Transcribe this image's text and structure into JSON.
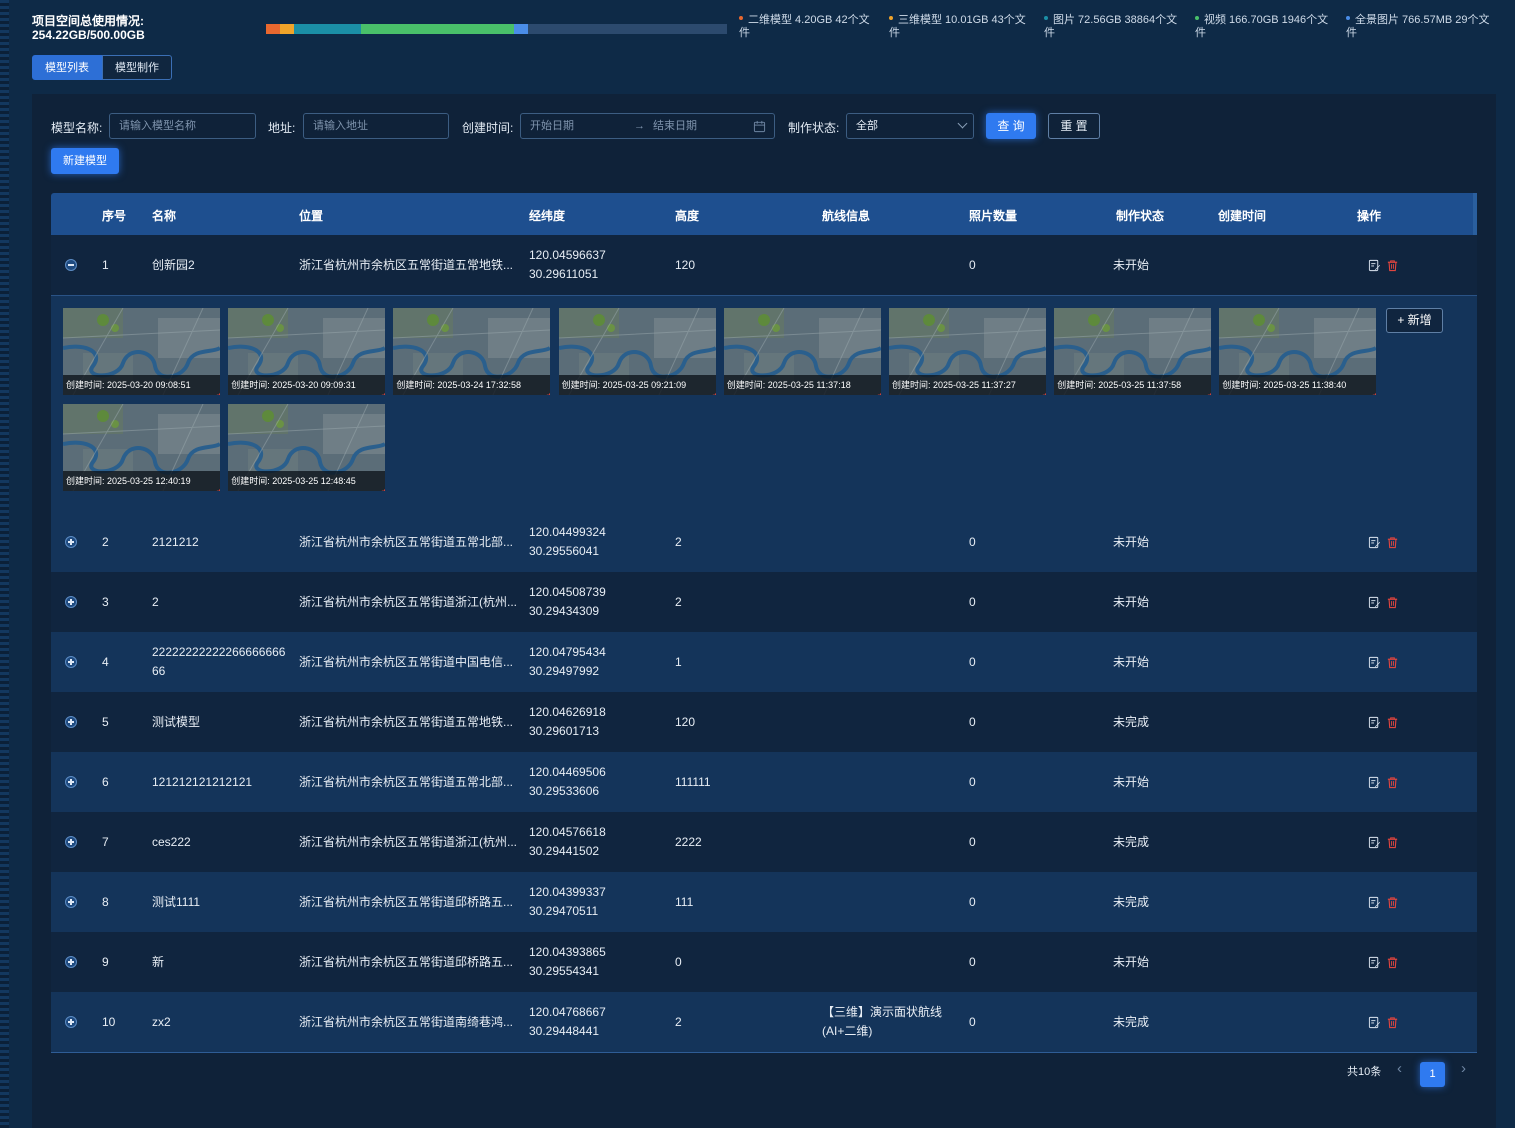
{
  "storage": {
    "title_line1": "项目空间总使用情况:",
    "title_line2": "254.22GB/500.00GB",
    "used_fraction": 0.508,
    "segments": [
      {
        "label": "二维模型 4.20GB 42个文件",
        "color": "#e8682f",
        "gb": 4.2
      },
      {
        "label": "三维模型 10.01GB 43个文件",
        "color": "#f0a42a",
        "gb": 10.01
      },
      {
        "label": "图片 72.56GB 38864个文件",
        "color": "#1b8fa6",
        "gb": 72.56
      },
      {
        "label": "视频 166.70GB 1946个文件",
        "color": "#49c06a",
        "gb": 166.7
      },
      {
        "label": "全景图片 766.57MB 29个文件",
        "color": "#4a8de8",
        "gb": 0.75
      }
    ],
    "legend": [
      {
        "line1": "二维模型 4.20GB 42个文",
        "line2": "件",
        "color": "#e8682f"
      },
      {
        "line1": "三维模型 10.01GB 43个文",
        "line2": "件",
        "color": "#f0a42a"
      },
      {
        "line1": "图片 72.56GB 38864个文",
        "line2": "件",
        "color": "#1b8fa6"
      },
      {
        "line1": "视频 166.70GB 1946个文",
        "line2": "件",
        "color": "#49c06a"
      },
      {
        "line1": "全景图片 766.57MB 29个文",
        "line2": "件",
        "color": "#4a8de8"
      }
    ]
  },
  "tabs": [
    {
      "label": "模型列表",
      "active": true
    },
    {
      "label": "模型制作",
      "active": false
    }
  ],
  "filters": {
    "name_label": "模型名称:",
    "name_placeholder": "请输入模型名称",
    "address_label": "地址:",
    "address_placeholder": "请输入地址",
    "time_label": "创建时间:",
    "start_placeholder": "开始日期",
    "range_sep": "→",
    "end_placeholder": "结束日期",
    "status_label": "制作状态:",
    "status_value": "全部",
    "query_label": "查 询",
    "reset_label": "重 置",
    "new_label": "新建模型"
  },
  "table": {
    "columns": [
      "序号",
      "名称",
      "位置",
      "经纬度",
      "高度",
      "航线信息",
      "照片数量",
      "制作状态",
      "创建时间",
      "操作"
    ],
    "rows": [
      {
        "index": "1",
        "name": "创新园2",
        "location": "浙江省杭州市余杭区五常街道五常地铁...",
        "lng": "120.04596637",
        "lat": "30.29611051",
        "height": "120",
        "route_1": "",
        "route_2": "",
        "photos": "0",
        "status": "未开始",
        "created": "",
        "expanded": true
      },
      {
        "index": "2",
        "name": "2121212",
        "location": "浙江省杭州市余杭区五常街道五常北部...",
        "lng": "120.04499324",
        "lat": "30.29556041",
        "height": "2",
        "route_1": "",
        "route_2": "",
        "photos": "0",
        "status": "未开始",
        "created": "",
        "expanded": false
      },
      {
        "index": "3",
        "name": "2",
        "location": "浙江省杭州市余杭区五常街道浙江(杭州...",
        "lng": "120.04508739",
        "lat": "30.29434309",
        "height": "2",
        "route_1": "",
        "route_2": "",
        "photos": "0",
        "status": "未开始",
        "created": "",
        "expanded": false
      },
      {
        "index": "4",
        "name": "22222222222266666666",
        "name_2": "66",
        "location": "浙江省杭州市余杭区五常街道中国电信...",
        "lng": "120.04795434",
        "lat": "30.29497992",
        "height": "1",
        "route_1": "",
        "route_2": "",
        "photos": "0",
        "status": "未开始",
        "created": "",
        "expanded": false
      },
      {
        "index": "5",
        "name": "测试模型",
        "location": "浙江省杭州市余杭区五常街道五常地铁...",
        "lng": "120.04626918",
        "lat": "30.29601713",
        "height": "120",
        "route_1": "",
        "route_2": "",
        "photos": "0",
        "status": "未完成",
        "created": "",
        "expanded": false
      },
      {
        "index": "6",
        "name": "121212121212121",
        "location": "浙江省杭州市余杭区五常街道五常北部...",
        "lng": "120.04469506",
        "lat": "30.29533606",
        "height": "111111",
        "route_1": "",
        "route_2": "",
        "photos": "0",
        "status": "未开始",
        "created": "",
        "expanded": false
      },
      {
        "index": "7",
        "name": "ces222",
        "location": "浙江省杭州市余杭区五常街道浙江(杭州...",
        "lng": "120.04576618",
        "lat": "30.29441502",
        "height": "2222",
        "route_1": "",
        "route_2": "",
        "photos": "0",
        "status": "未完成",
        "created": "",
        "expanded": false
      },
      {
        "index": "8",
        "name": "测试1111",
        "location": "浙江省杭州市余杭区五常街道邱桥路五...",
        "lng": "120.04399337",
        "lat": "30.29470511",
        "height": "111",
        "route_1": "",
        "route_2": "",
        "photos": "0",
        "status": "未完成",
        "created": "",
        "expanded": false
      },
      {
        "index": "9",
        "name": "新",
        "location": "浙江省杭州市余杭区五常街道邱桥路五...",
        "lng": "120.04393865",
        "lat": "30.29554341",
        "height": "0",
        "route_1": "",
        "route_2": "",
        "photos": "0",
        "status": "未开始",
        "created": "",
        "expanded": false
      },
      {
        "index": "10",
        "name": "zx2",
        "location": "浙江省杭州市余杭区五常街道南绮巷鸿...",
        "lng": "120.04768667",
        "lat": "30.29448441",
        "height": "2",
        "route_1": "【三维】演示面状航线",
        "route_2": "(AI+二维)",
        "photos": "0",
        "status": "未完成",
        "created": "",
        "expanded": false
      }
    ],
    "photos": [
      {
        "caption": "创建时间:  2025-03-20 09:08:51"
      },
      {
        "caption": "创建时间:  2025-03-20 09:09:31"
      },
      {
        "caption": "创建时间:  2025-03-24 17:32:58"
      },
      {
        "caption": "创建时间:  2025-03-25 09:21:09"
      },
      {
        "caption": "创建时间:  2025-03-25 11:37:18"
      },
      {
        "caption": "创建时间:  2025-03-25 11:37:27"
      },
      {
        "caption": "创建时间:  2025-03-25 11:37:58"
      },
      {
        "caption": "创建时间:  2025-03-25 11:38:40"
      },
      {
        "caption": "创建时间:  2025-03-25 12:40:19"
      },
      {
        "caption": "创建时间:  2025-03-25 12:48:45"
      }
    ],
    "add_label": "+ 新增"
  },
  "pagination": {
    "total": "共10条",
    "current": "1",
    "prev": "‹",
    "next": "›"
  }
}
